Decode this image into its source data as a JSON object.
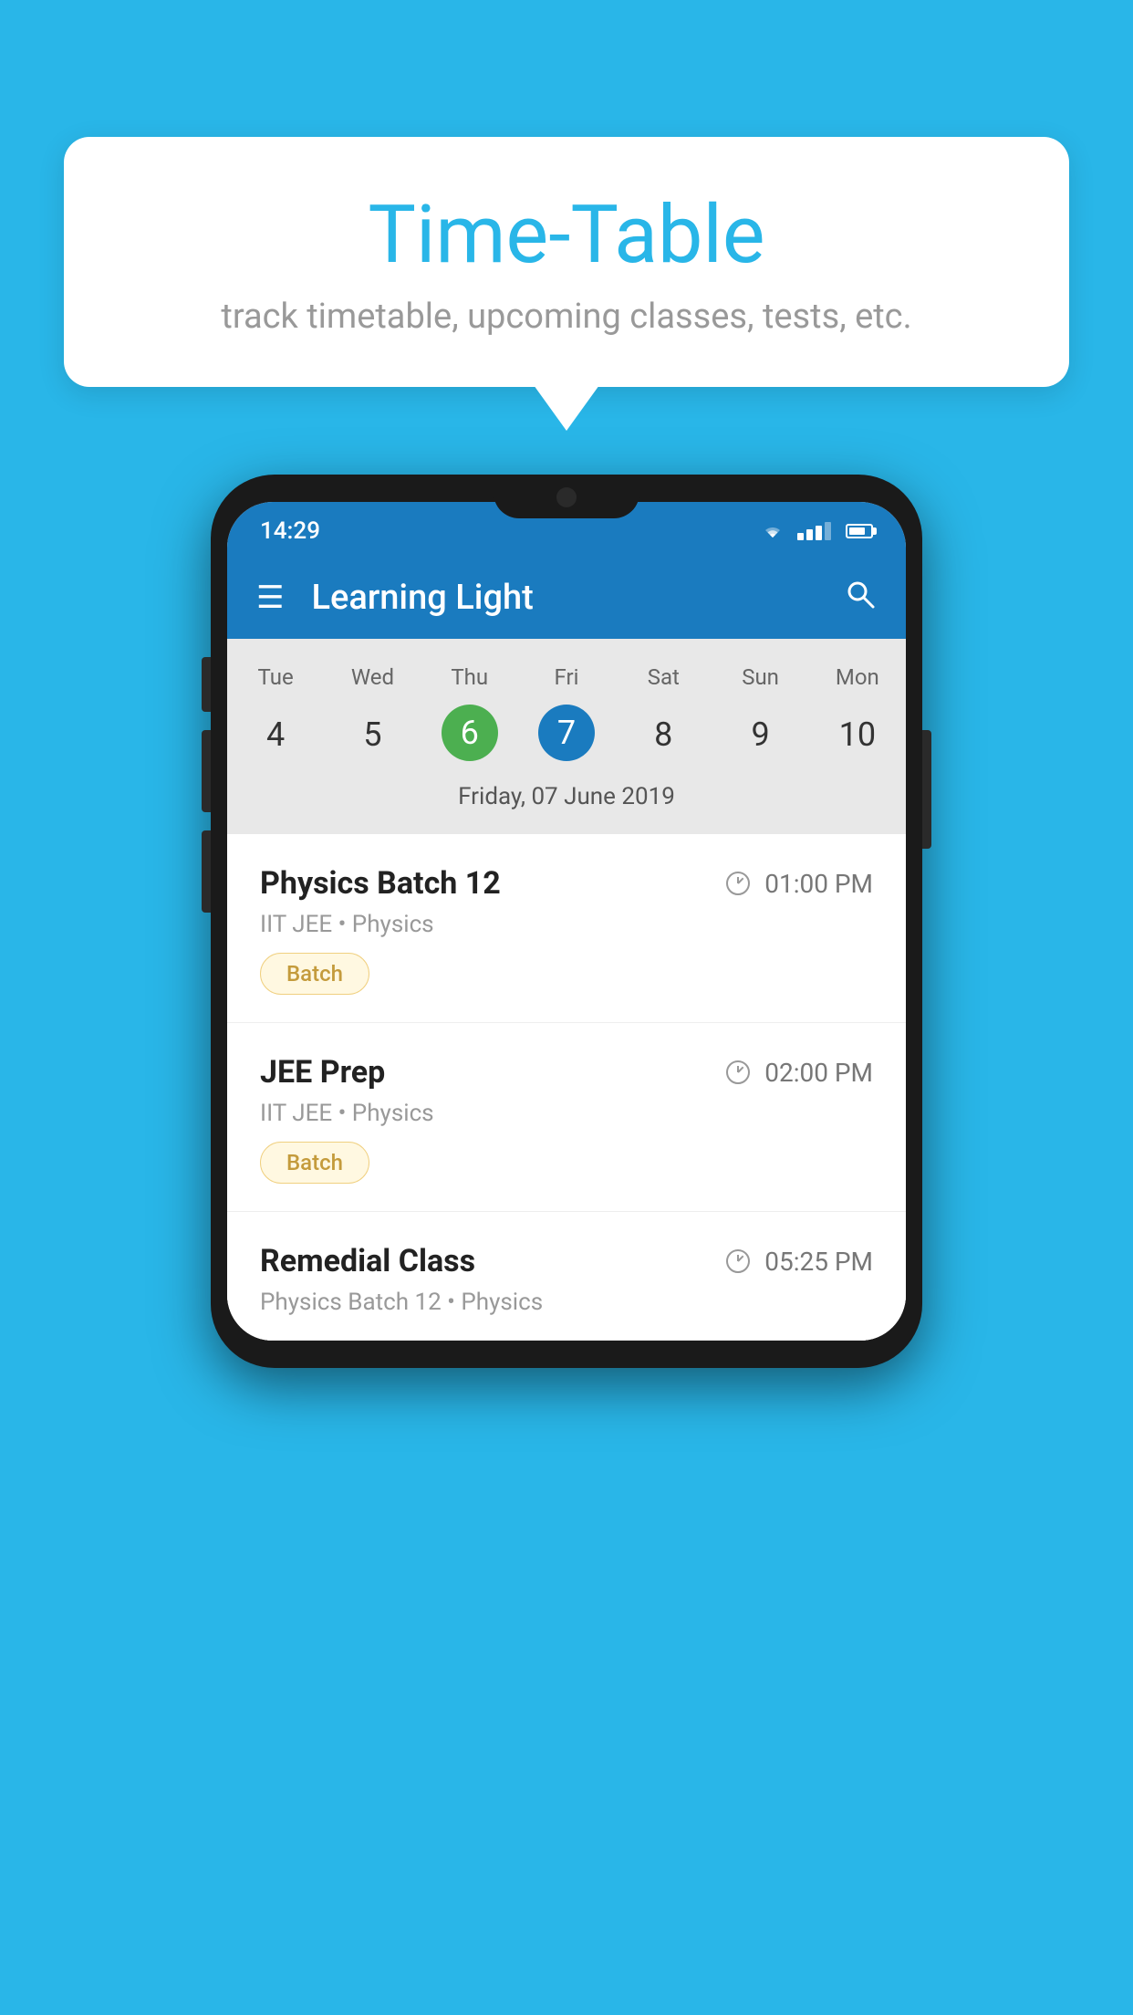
{
  "background_color": "#29b6e8",
  "speech_bubble": {
    "title": "Time-Table",
    "subtitle": "track timetable, upcoming classes, tests, etc."
  },
  "phone": {
    "status_bar": {
      "time": "14:29"
    },
    "toolbar": {
      "title": "Learning Light"
    },
    "calendar": {
      "days": [
        "Tue",
        "Wed",
        "Thu",
        "Fri",
        "Sat",
        "Sun",
        "Mon"
      ],
      "dates": [
        "4",
        "5",
        "6",
        "7",
        "8",
        "9",
        "10"
      ],
      "today_index": 2,
      "selected_index": 3,
      "selected_date_label": "Friday, 07 June 2019"
    },
    "schedule_items": [
      {
        "name": "Physics Batch 12",
        "time": "01:00 PM",
        "sub": "IIT JEE • Physics",
        "tag": "Batch"
      },
      {
        "name": "JEE Prep",
        "time": "02:00 PM",
        "sub": "IIT JEE • Physics",
        "tag": "Batch"
      },
      {
        "name": "Remedial Class",
        "time": "05:25 PM",
        "sub": "Physics Batch 12 • Physics",
        "tag": null
      }
    ]
  }
}
